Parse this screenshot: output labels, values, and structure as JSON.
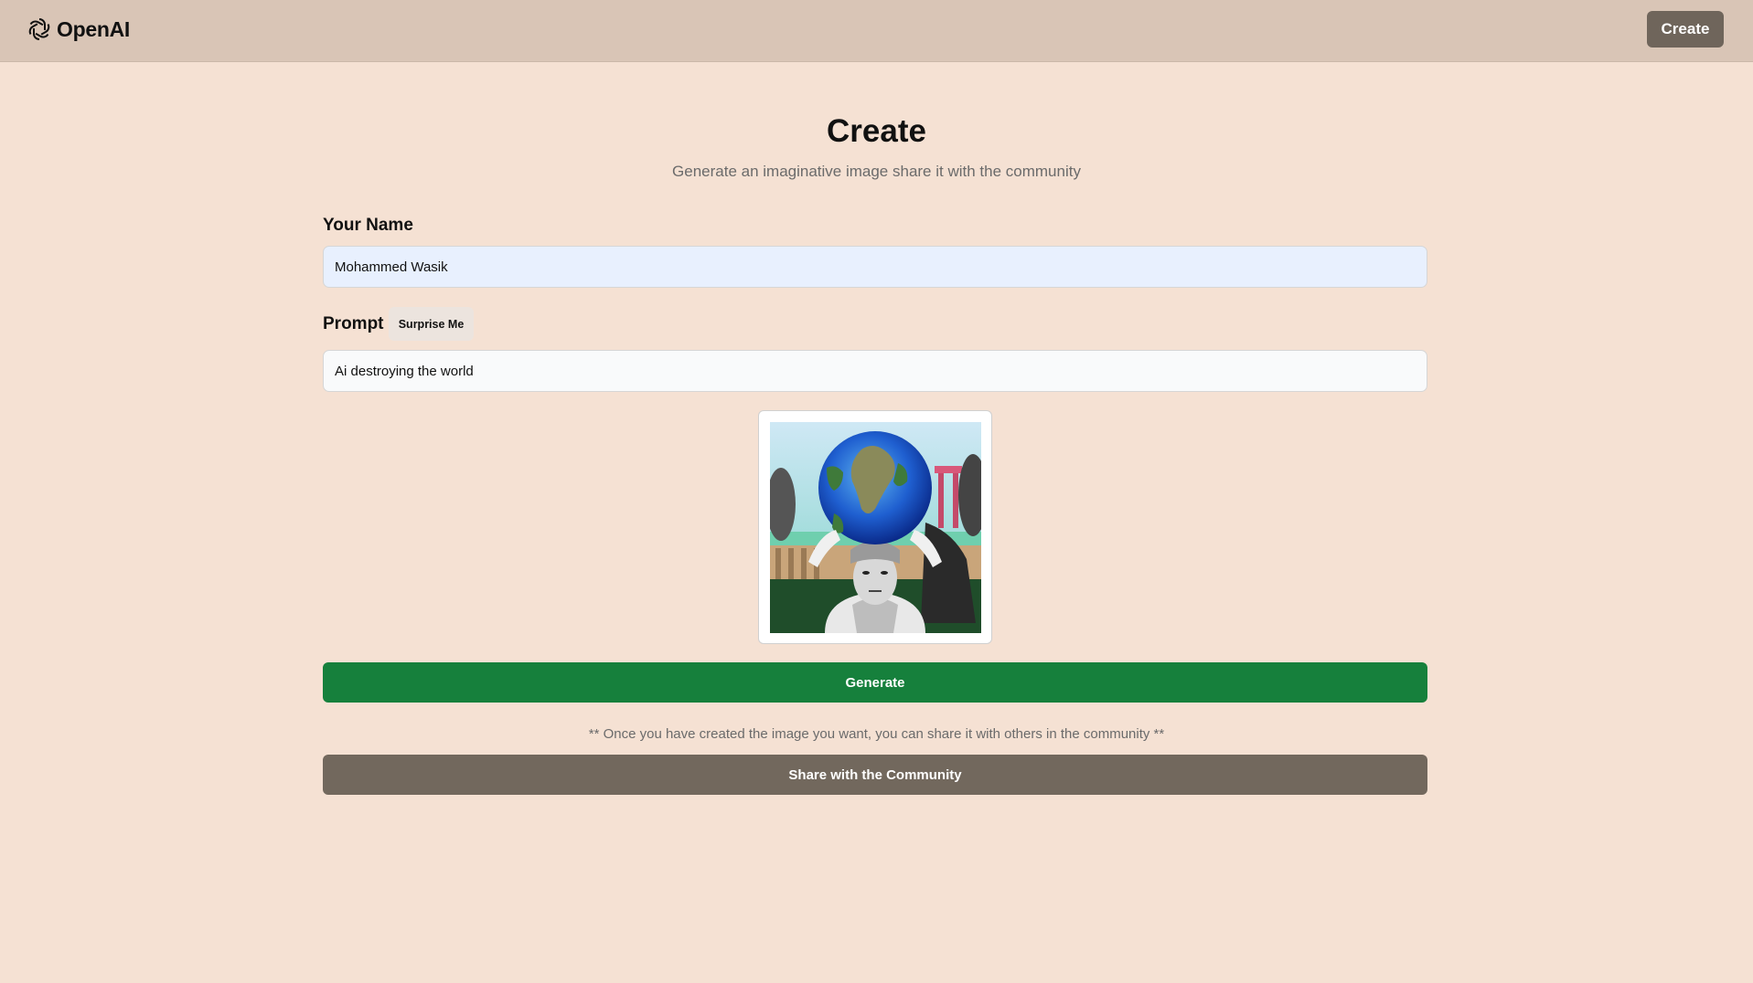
{
  "header": {
    "logo_text": "OpenAI",
    "logo_icon": "openai-logo-icon",
    "create_button": "Create"
  },
  "page": {
    "title": "Create",
    "subtitle": "Generate an imaginative image share it with the community"
  },
  "form": {
    "name_label": "Your Name",
    "name_value": "Mohammed Wasik",
    "prompt_label": "Prompt",
    "surprise_button": "Surprise Me",
    "prompt_value": "Ai destroying the world",
    "generate_button": "Generate",
    "note": "** Once you have created the image you want, you can share it with others in the community **",
    "share_button": "Share with the Community"
  },
  "colors": {
    "background": "#f5e1d3",
    "header_bg": "#d9c5b6",
    "header_button": "#6f655b",
    "generate_bg": "#16803c",
    "share_bg": "#72685d",
    "name_field_bg": "#e8f0fe"
  }
}
